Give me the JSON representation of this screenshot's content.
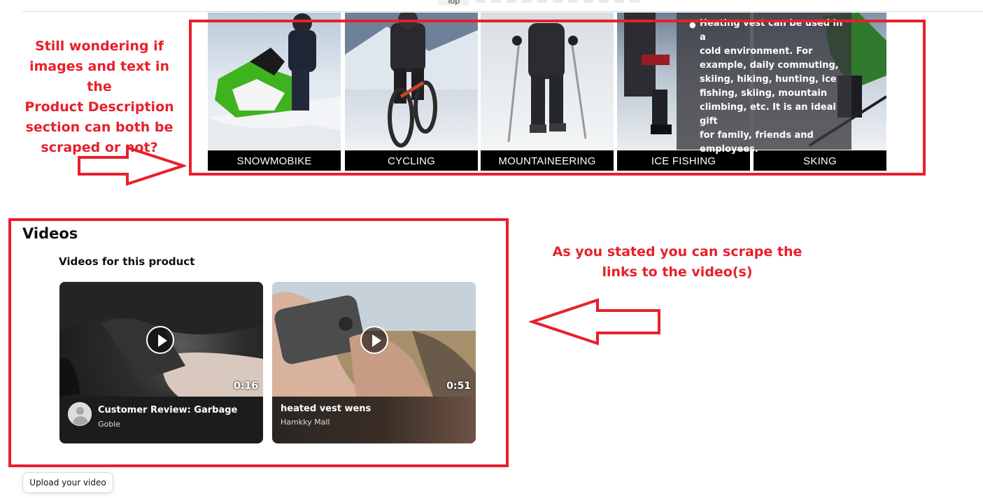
{
  "top_bar": {
    "tab_label": "Top"
  },
  "banner": {
    "captions": [
      "SNOWMOBIKE",
      "CYCLING",
      "MOUNTAINEERING",
      "ICE FISHING",
      "SKING"
    ],
    "description_lines": [
      "Heating vest can be used in a",
      "cold environment. For",
      "example, daily commuting,",
      "skiing, hiking, hunting, ice",
      "fishing, skiing, mountain",
      "climbing, etc. It is an ideal gift",
      "for family, friends and",
      "employees."
    ]
  },
  "annotations": {
    "left_note_lines": [
      "Still wondering if",
      "images and text in the",
      "Product Description",
      "section can both be",
      "scraped or not?"
    ],
    "right_note_lines": [
      "As you stated you can scrape the",
      "links to the video(s)"
    ],
    "color": "#e8202c"
  },
  "videos": {
    "title": "Videos",
    "subtitle": "Videos for this product",
    "items": [
      {
        "title": "Customer Review: Garbage",
        "author": "Goble",
        "duration": "0:16"
      },
      {
        "title": "heated vest wens",
        "author": "Hamkky Mall",
        "duration": "0:51"
      }
    ],
    "upload_label": "Upload your video"
  }
}
